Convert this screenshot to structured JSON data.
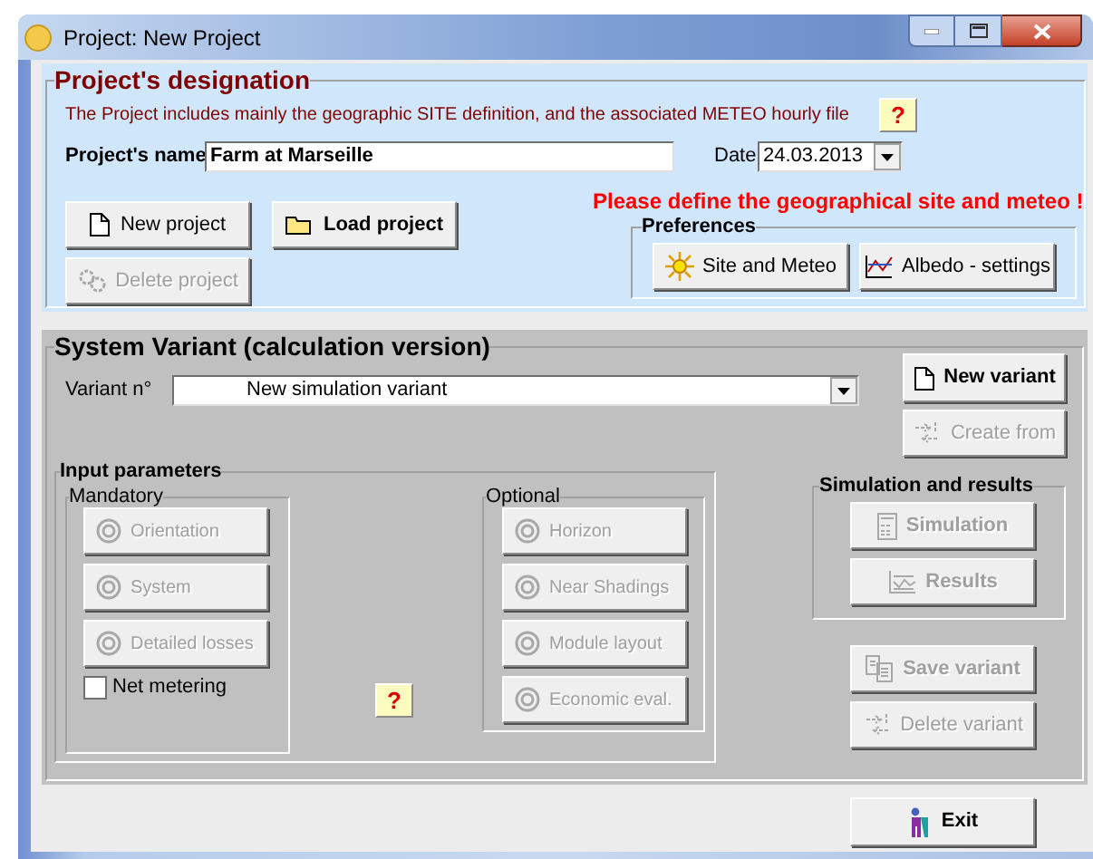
{
  "window": {
    "title": "Project:  New Project"
  },
  "designation": {
    "title": "Project's designation",
    "description": "The Project includes mainly the geographic SITE definition, and the associated  METEO  hourly file",
    "help": "?",
    "name_label": "Project's name",
    "name_value": "Farm at Marseille",
    "date_label": "Date",
    "date_value": "24.03.2013",
    "warning": "Please define the geographical site and meteo !",
    "buttons": [
      {
        "label": "New project",
        "disabled": false,
        "bold": false
      },
      {
        "label": "Load project",
        "disabled": false,
        "bold": true
      },
      {
        "label": "Delete project",
        "disabled": true,
        "bold": false
      }
    ]
  },
  "preferences": {
    "title": "Preferences",
    "buttons": [
      {
        "label": "Site and Meteo",
        "disabled": false,
        "bold": false
      },
      {
        "label": "Albedo - settings",
        "disabled": false,
        "bold": false
      }
    ]
  },
  "variant": {
    "title": "System Variant (calculation version)",
    "label": "Variant n°",
    "value": "New simulation variant",
    "buttons": [
      {
        "label": "New variant",
        "disabled": false,
        "bold": true
      },
      {
        "label": "Create from",
        "disabled": true,
        "bold": false
      }
    ]
  },
  "input_parameters": {
    "title": "Input parameters",
    "help": "?",
    "mandatory": {
      "title": "Mandatory",
      "buttons": [
        {
          "label": "Orientation",
          "disabled": true,
          "bold": false
        },
        {
          "label": "System",
          "disabled": true,
          "bold": false
        },
        {
          "label": "Detailed losses",
          "disabled": true,
          "bold": false
        }
      ],
      "net_metering": {
        "label": "Net metering",
        "checked": false
      }
    },
    "optional": {
      "title": "Optional",
      "buttons": [
        {
          "label": "Horizon",
          "disabled": true,
          "bold": false
        },
        {
          "label": "Near Shadings",
          "disabled": true,
          "bold": false
        },
        {
          "label": "Module layout",
          "disabled": true,
          "bold": false
        },
        {
          "label": "Economic eval.",
          "disabled": true,
          "bold": false
        }
      ]
    }
  },
  "simulation": {
    "title": "Simulation and results",
    "buttons": [
      {
        "label": "Simulation",
        "disabled": true,
        "bold": true
      },
      {
        "label": "Results",
        "disabled": true,
        "bold": true
      }
    ]
  },
  "variant_actions": [
    {
      "label": "Save variant",
      "disabled": true,
      "bold": true
    },
    {
      "label": "Delete variant",
      "disabled": true,
      "bold": false
    }
  ],
  "exit": {
    "label": "Exit",
    "disabled": false,
    "bold": true
  }
}
